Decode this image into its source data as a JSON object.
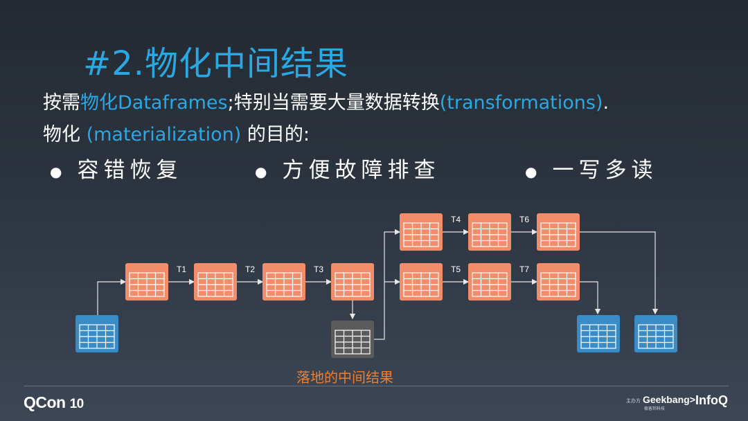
{
  "title": "#2.物化中间结果",
  "intro": {
    "line1_a": "按需",
    "line1_b": "物化",
    "line1_c": "Dataframes",
    "line1_d": ";特别当需要大量数据转换",
    "line1_e": "(transformations)",
    "line1_f": ".",
    "line2_a": "物化 ",
    "line2_b": "(materialization)",
    "line2_c": " 的目的:"
  },
  "bullets": [
    "容错恢复",
    "方便故障排查",
    "一写多读"
  ],
  "diagram": {
    "transform_labels": [
      "T1",
      "T2",
      "T3",
      "T4",
      "T5",
      "T6",
      "T7"
    ],
    "cache_label": "落地的中间结果",
    "colors": {
      "source": "#3a8cc7",
      "intermediate": "#f28d6c",
      "cached": "#5b5b5b",
      "output": "#3a8cc7",
      "arrow": "#e6e6e6"
    }
  },
  "footer": {
    "conference": "QCon",
    "edition": "10",
    "sponsor": "主办方",
    "organizer": "Geekbang>.",
    "organizer_sub": "极客邦科技",
    "partner": "InfoQ"
  }
}
